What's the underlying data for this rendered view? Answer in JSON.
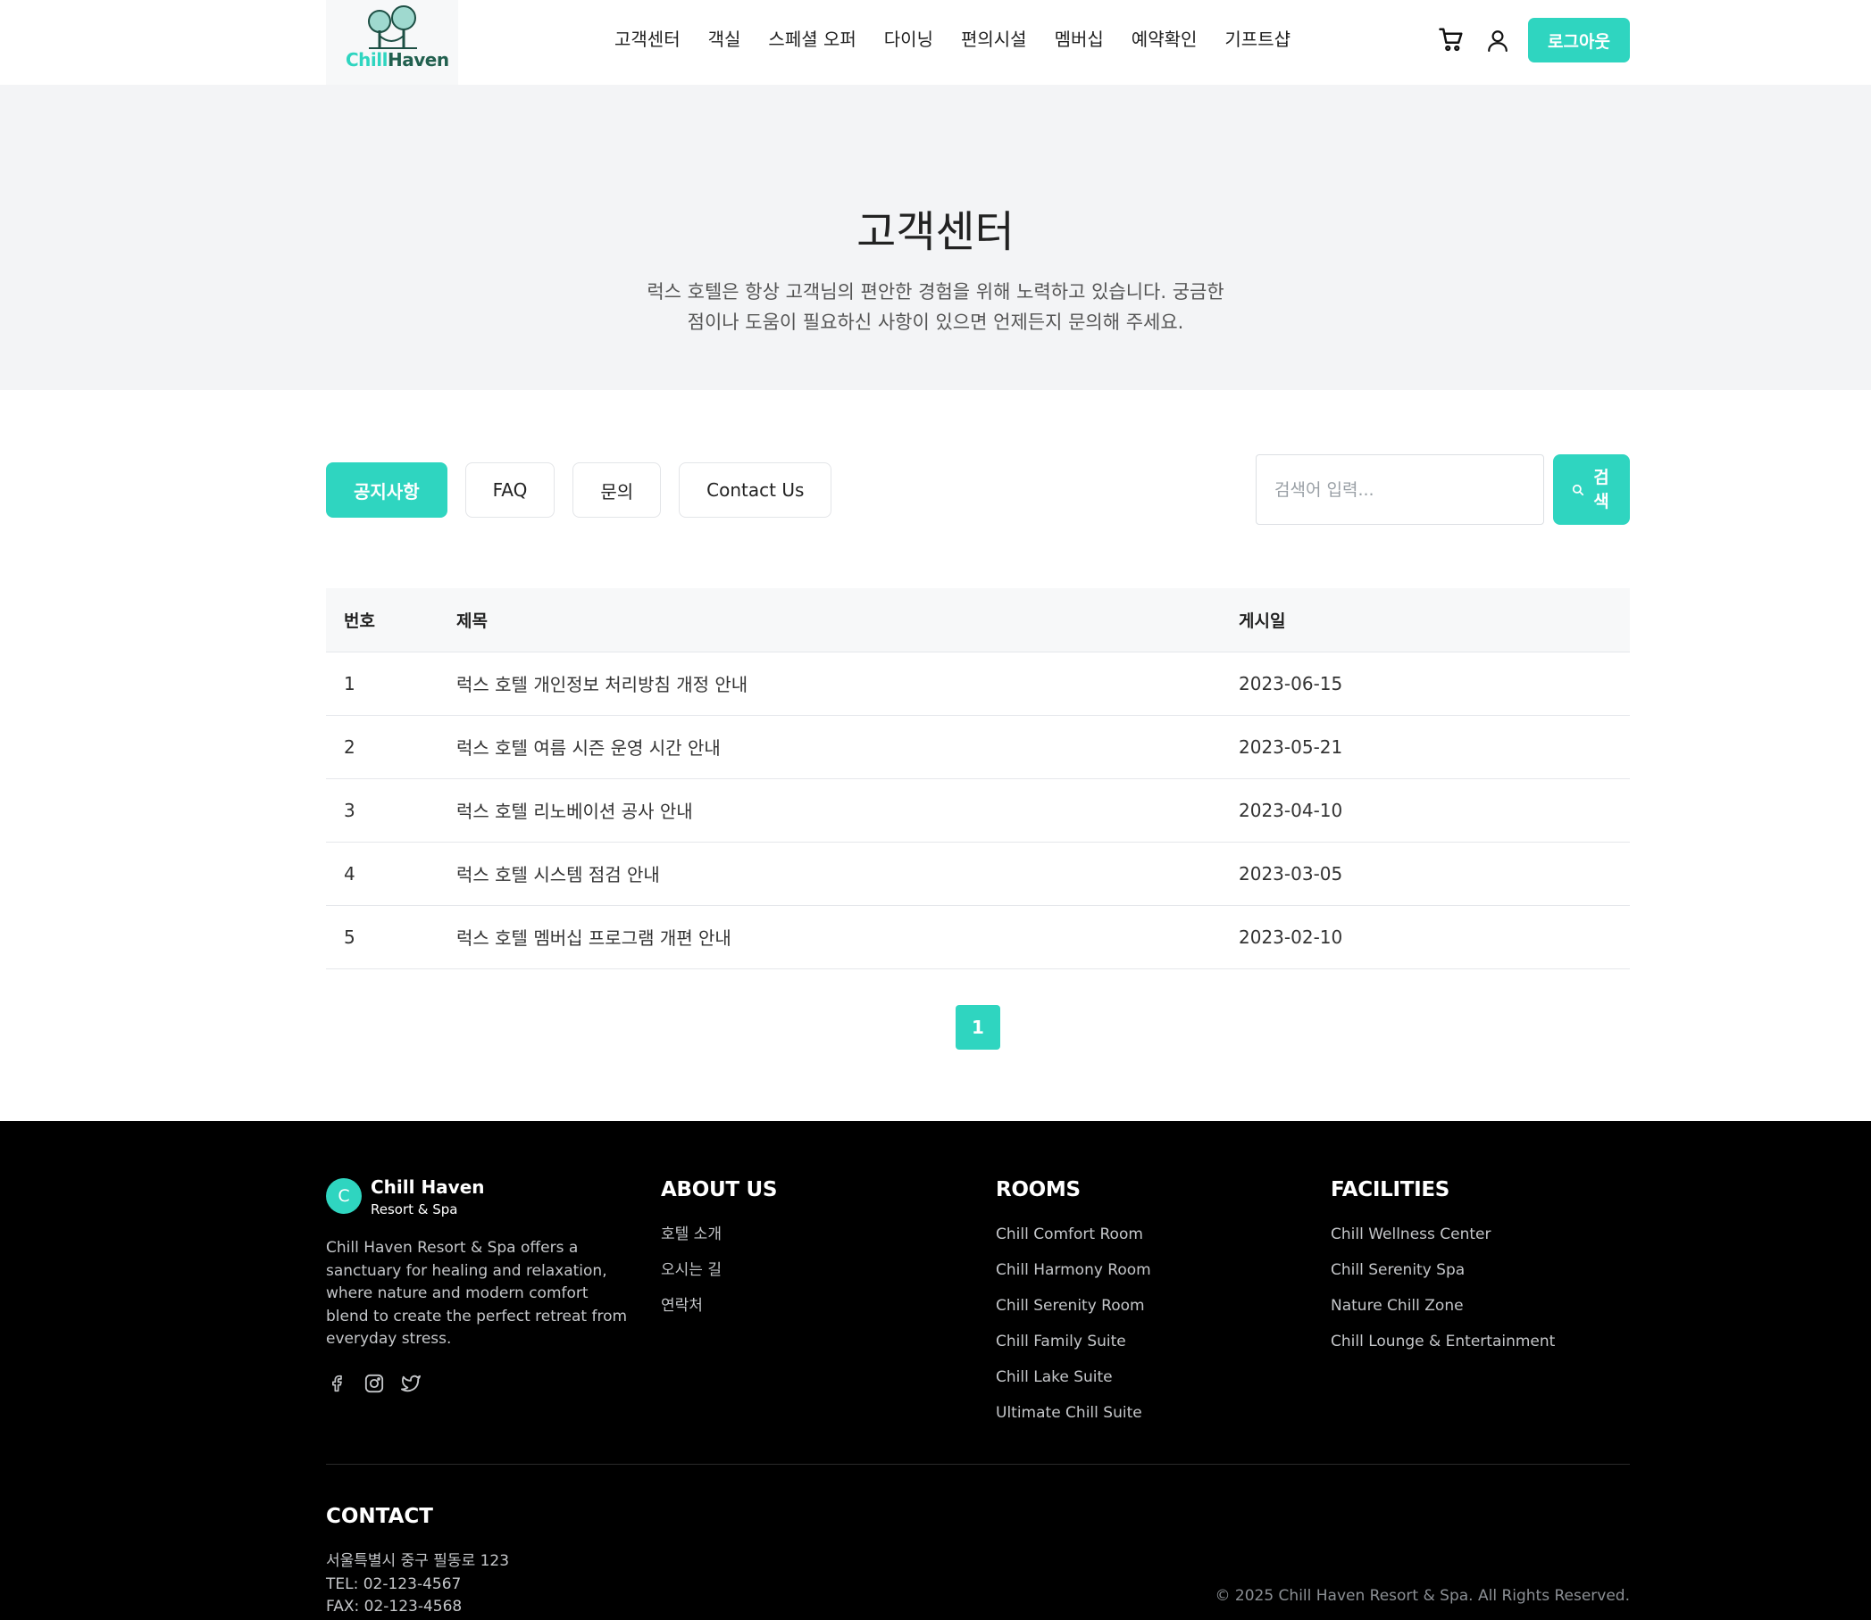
{
  "header": {
    "logo_part1": "Chill",
    "logo_part2": "Haven",
    "nav": [
      "고객센터",
      "객실",
      "스페셜 오퍼",
      "다이닝",
      "편의시설",
      "멤버십",
      "예약확인",
      "기프트샵"
    ],
    "logout_label": "로그아웃"
  },
  "hero": {
    "title": "고객센터",
    "description": "럭스 호텔은 항상 고객님의 편안한 경험을 위해 노력하고 있습니다. 궁금한 점이나 도움이 필요하신 사항이 있으면 언제든지 문의해 주세요."
  },
  "tabs": [
    {
      "label": "공지사항",
      "active": true
    },
    {
      "label": "FAQ",
      "active": false
    },
    {
      "label": "문의",
      "active": false
    },
    {
      "label": "Contact Us",
      "active": false
    }
  ],
  "search": {
    "placeholder": "검색어 입력...",
    "button_label": "검색"
  },
  "table": {
    "headers": [
      "번호",
      "제목",
      "게시일"
    ],
    "rows": [
      {
        "no": "1",
        "title": "럭스 호텔 개인정보 처리방침 개정 안내",
        "date": "2023-06-15"
      },
      {
        "no": "2",
        "title": "럭스 호텔 여름 시즌 운영 시간 안내",
        "date": "2023-05-21"
      },
      {
        "no": "3",
        "title": "럭스 호텔 리노베이션 공사 안내",
        "date": "2023-04-10"
      },
      {
        "no": "4",
        "title": "럭스 호텔 시스템 점검 안내",
        "date": "2023-03-05"
      },
      {
        "no": "5",
        "title": "럭스 호텔 멤버십 프로그램 개편 안내",
        "date": "2023-02-10"
      }
    ]
  },
  "pagination": {
    "current": "1"
  },
  "footer": {
    "brand_initial": "C",
    "brand_name": "Chill Haven",
    "brand_sub": "Resort & Spa",
    "brand_desc": "Chill Haven Resort & Spa offers a sanctuary for healing and relaxation, where nature and modern comfort blend to create the perfect retreat from everyday stress.",
    "about": {
      "title": "ABOUT US",
      "links": [
        "호텔 소개",
        "오시는 길",
        "연락처"
      ]
    },
    "rooms": {
      "title": "ROOMS",
      "links": [
        "Chill Comfort Room",
        "Chill Harmony Room",
        "Chill Serenity Room",
        "Chill Family Suite",
        "Chill Lake Suite",
        "Ultimate Chill Suite"
      ]
    },
    "facilities": {
      "title": "FACILITIES",
      "links": [
        "Chill Wellness Center",
        "Chill Serenity Spa",
        "Nature Chill Zone",
        "Chill Lounge & Entertainment"
      ]
    },
    "contact": {
      "title": "CONTACT",
      "address": "서울특별시 중구 필동로 123",
      "tel": "TEL: 02-123-4567",
      "fax": "FAX: 02-123-4568"
    },
    "copyright": "© 2025 Chill Haven Resort & Spa. All Rights Reserved."
  },
  "colors": {
    "accent": "#2fd5c0",
    "footer_bg": "#000000",
    "hero_bg": "#f3f4f6"
  }
}
